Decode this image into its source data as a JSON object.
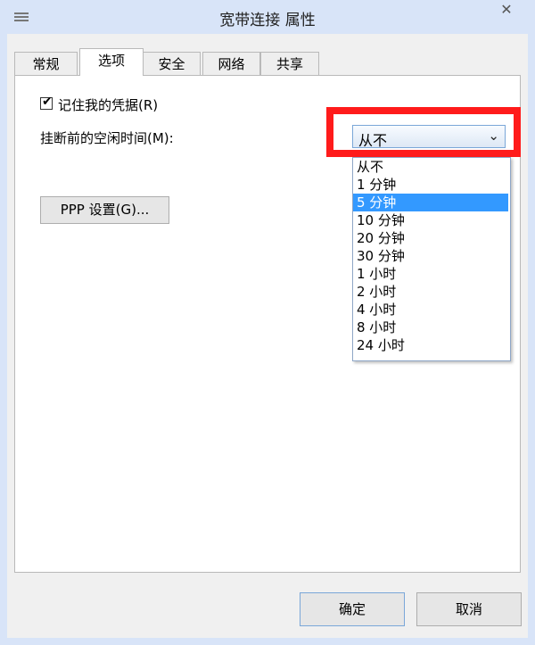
{
  "window": {
    "title": "宽带连接 属性",
    "close_glyph": "✕"
  },
  "tabs": [
    {
      "label": "常规"
    },
    {
      "label": "选项"
    },
    {
      "label": "安全"
    },
    {
      "label": "网络"
    },
    {
      "label": "共享"
    }
  ],
  "options": {
    "remember_credentials": {
      "label": "记住我的凭据(R)",
      "checked": true
    },
    "idle_timeout": {
      "label": "挂断前的空闲时间(M):",
      "selected_value": "从不",
      "dropdown_options": [
        "从不",
        "1 分钟",
        "5 分钟",
        "10 分钟",
        "20 分钟",
        "30 分钟",
        "1 小时",
        "2 小时",
        "4 小时",
        "8 小时",
        "24 小时"
      ],
      "highlighted_option": "5 分钟"
    },
    "ppp_button": "PPP 设置(G)..."
  },
  "footer": {
    "ok_label": "确定",
    "cancel_label": "取消"
  },
  "icons": [
    "window-menu-icon",
    "checkmark-icon",
    "chevron-down-icon",
    "close-icon"
  ],
  "colors": {
    "highlight_border": "#ff1b1b",
    "selection": "#3399ff",
    "title_bar": "#d8e4f8"
  }
}
